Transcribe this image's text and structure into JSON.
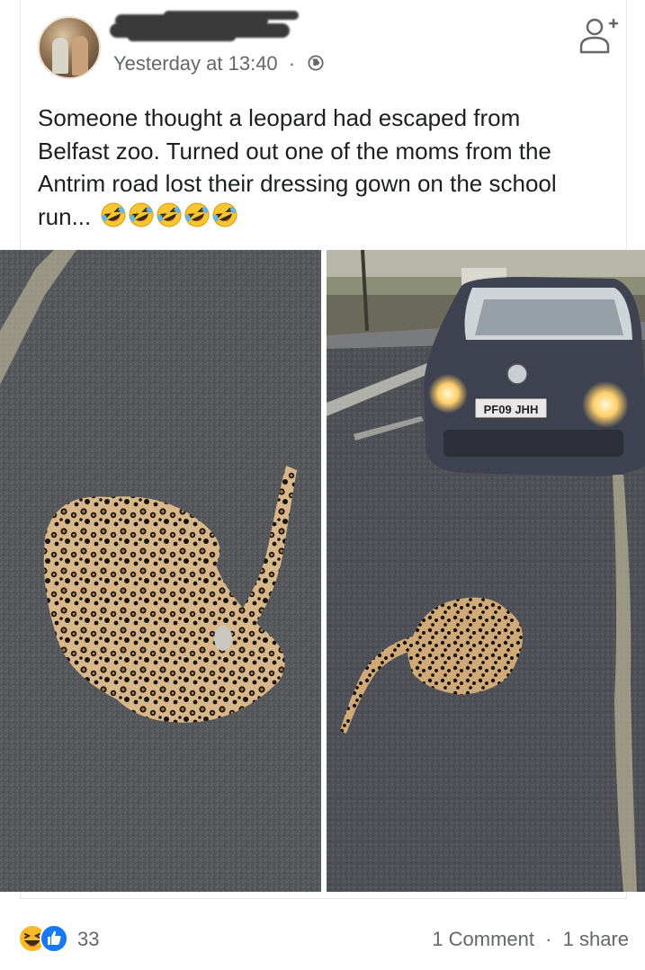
{
  "post": {
    "author_name": "",
    "timestamp": "Yesterday at 13:40",
    "separator": "·",
    "audience_icon": "globe-icon",
    "text_lines": [
      "Someone thought a leopard had escaped from",
      "Belfast zoo. Turned out one of the moms from the",
      "Antrim road  lost their dressing gown on the school",
      "run..."
    ],
    "emojis": [
      "rolling-on-floor-laughing",
      "rolling-on-floor-laughing",
      "rolling-on-floor-laughing",
      "rolling-on-floor-laughing",
      "rolling-on-floor-laughing"
    ],
    "photos": [
      {
        "name": "leopard-print-gown-closeup"
      },
      {
        "name": "leopard-print-gown-with-car",
        "plate_text": "PF09 JHH"
      }
    ]
  },
  "footer": {
    "reaction_icons": [
      "haha-reaction-icon",
      "like-reaction-icon"
    ],
    "reaction_count": "33",
    "comments": "1 Comment",
    "dot": "·",
    "shares": "1 share"
  },
  "colors": {
    "text": "#1c1e21",
    "secondary": "#65676b",
    "like_blue": "#1877f2",
    "haha_yellow": "#f7b928"
  }
}
